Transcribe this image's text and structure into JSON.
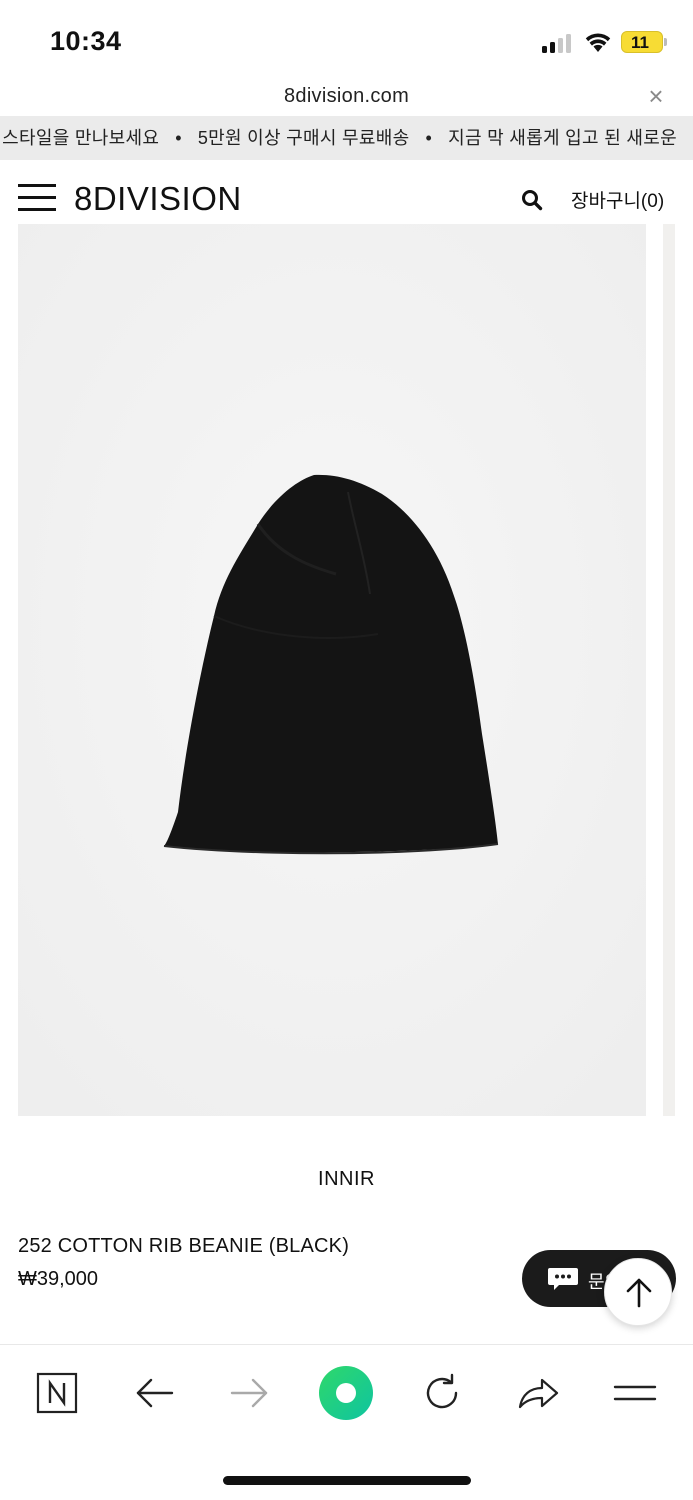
{
  "status_bar": {
    "time": "10:34",
    "battery": "11"
  },
  "browser": {
    "url": "8division.com",
    "close_symbol": "×"
  },
  "marquee": {
    "items": [
      "트 스타일을 만나보세요",
      "5만원 이상 구매시 무료배송",
      "지금 막 새롭게 입고 된 새로운"
    ],
    "separator": "•"
  },
  "header": {
    "logo": "8DIVISION",
    "cart_label": "장바구니(0)"
  },
  "product": {
    "brand": "INNIR",
    "name": "252 COTTON RIB BEANIE (BLACK)",
    "price": "₩39,000"
  },
  "floating": {
    "inquiry_label": "문의하기"
  },
  "icons": {
    "menu": "hamburger-icon",
    "search": "search-icon",
    "chat": "chat-bubble-icon",
    "scroll_top": "arrow-up-icon",
    "toolbar": [
      "naver-home-icon",
      "back-arrow-icon",
      "forward-arrow-icon",
      "green-dot-icon",
      "reload-icon",
      "share-icon",
      "menu-lines-icon"
    ]
  },
  "colors": {
    "accent_green": "#19ce60",
    "marquee_bg": "#ebebeb",
    "battery_yellow": "#f7dc34",
    "beanie": "#141414"
  }
}
